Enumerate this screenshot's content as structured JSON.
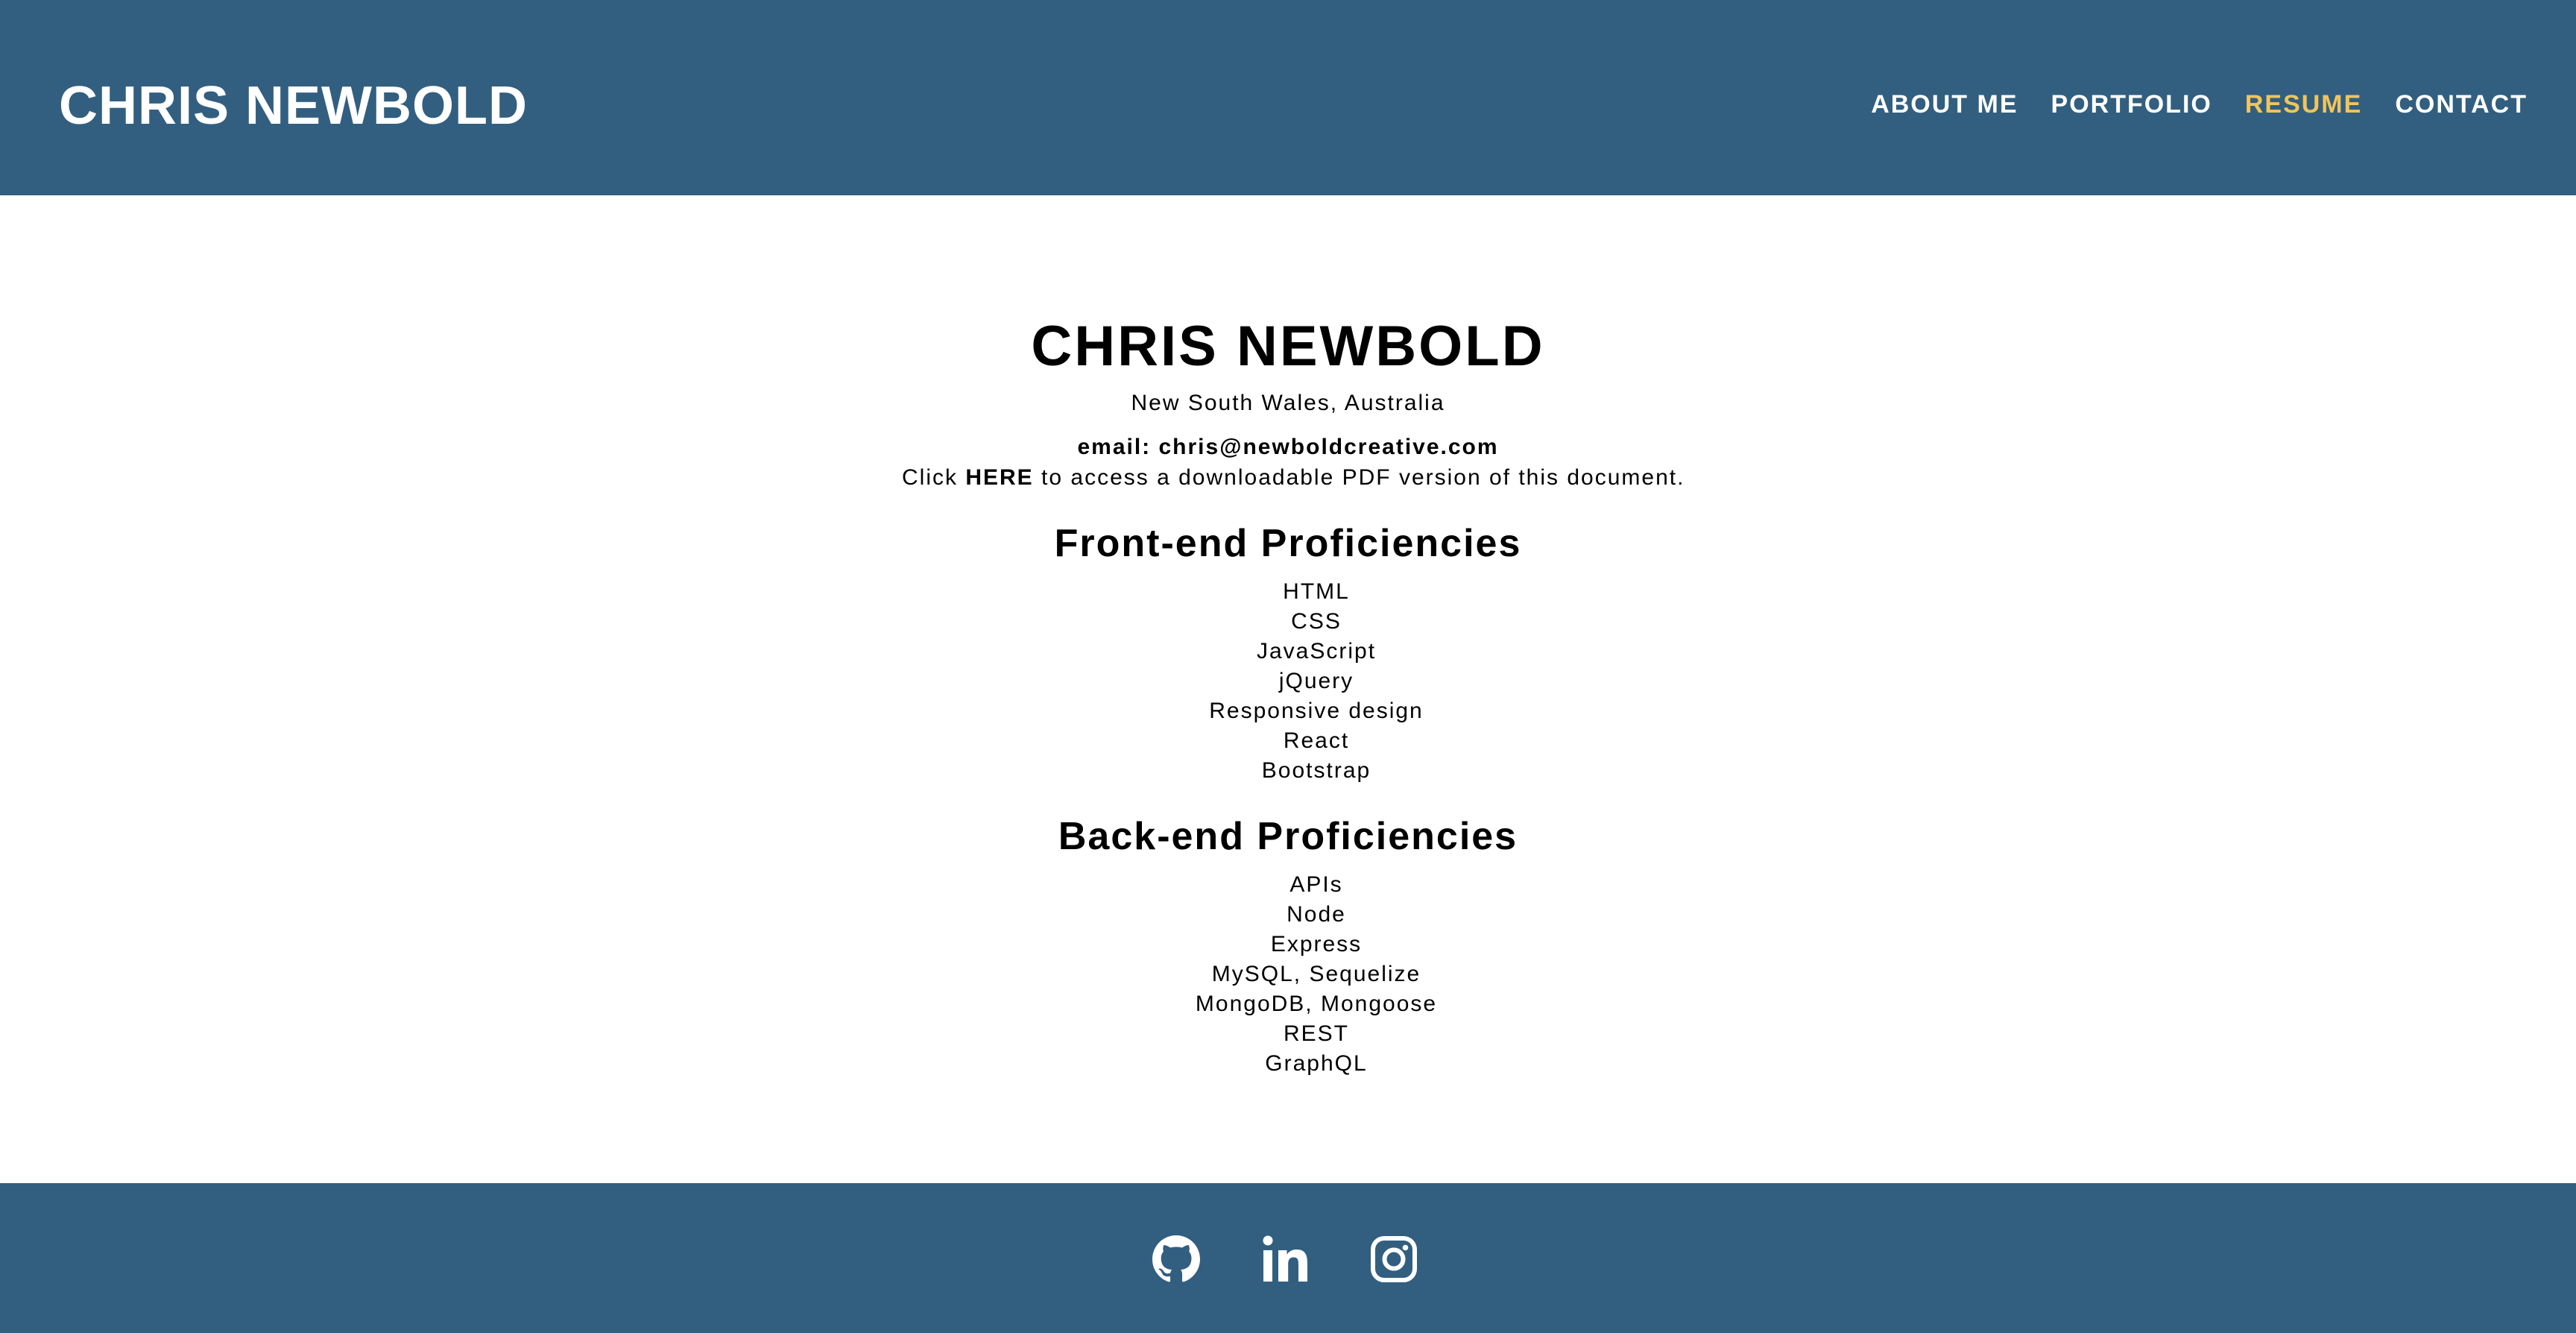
{
  "header": {
    "site_title": "CHRIS NEWBOLD",
    "nav": [
      {
        "label": "ABOUT ME"
      },
      {
        "label": "PORTFOLIO"
      },
      {
        "label": "RESUME"
      },
      {
        "label": "CONTACT"
      }
    ],
    "active_nav": "RESUME"
  },
  "resume": {
    "name": "CHRIS NEWBOLD",
    "location": "New South Wales, Australia",
    "email": "email: chris@newboldcreative.com",
    "pdf_prefix": "Click",
    "pdf_link": "HERE",
    "pdf_suffix": "to access a downloadable PDF version of this document.",
    "frontend_heading": "Front-end Proficiencies",
    "frontend": [
      "HTML",
      "CSS",
      "JavaScript",
      "jQuery",
      "Responsive design",
      "React",
      "Bootstrap"
    ],
    "backend_heading": "Back-end Proficiencies",
    "backend": [
      "APIs",
      "Node",
      "Express",
      "MySQL, Sequelize",
      "MongoDB, Mongoose",
      "REST",
      "GraphQL"
    ]
  },
  "footer": {
    "icons": [
      "github-icon",
      "linkedin-icon",
      "instagram-icon"
    ]
  },
  "colors": {
    "header_bg": "#325f80",
    "accent": "#f2c45a",
    "text": "#000000"
  }
}
